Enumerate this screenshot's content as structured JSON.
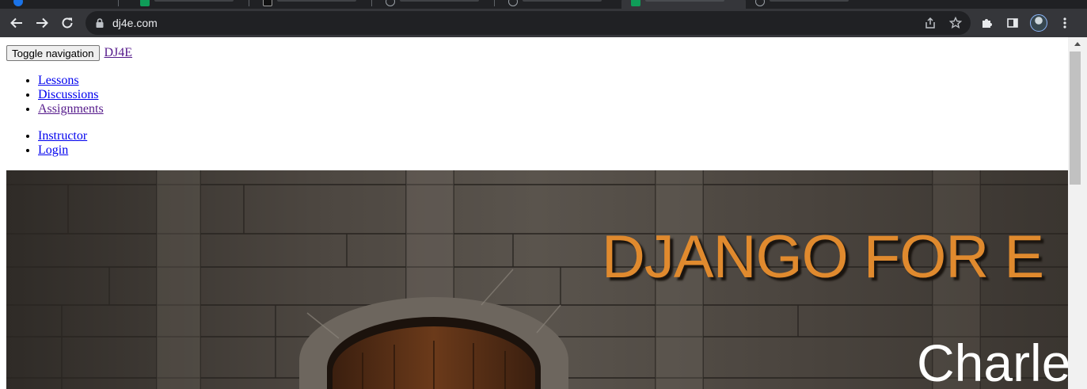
{
  "browser": {
    "url": "dj4e.com"
  },
  "page": {
    "toggle_label": "Toggle navigation",
    "brand": "DJ4E",
    "nav_main": [
      "Lessons",
      "Discussions",
      "Assignments"
    ],
    "nav_right": [
      "Instructor",
      "Login"
    ]
  },
  "hero": {
    "title": "DJANGO FOR E",
    "name": "Charle"
  },
  "colors": {
    "hero_title": "#e08a2e",
    "link": "#0000ee",
    "visited_link": "#551a8b",
    "chrome_toolbar": "#35363a",
    "chrome_tabstrip": "#202124"
  }
}
